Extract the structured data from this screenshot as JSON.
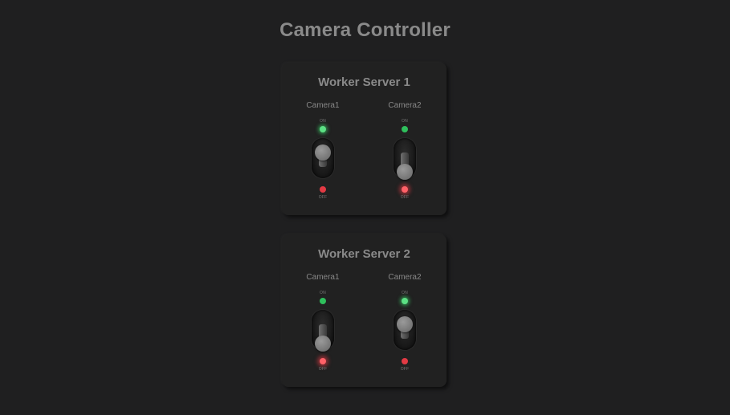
{
  "app": {
    "title": "Camera Controller"
  },
  "servers": [
    {
      "name": "Worker Server 1",
      "cameras": [
        {
          "label": "Camera1",
          "on_label": "ON",
          "off_label": "OFF",
          "state": "on"
        },
        {
          "label": "Camera2",
          "on_label": "ON",
          "off_label": "OFF",
          "state": "off"
        }
      ]
    },
    {
      "name": "Worker Server 2",
      "cameras": [
        {
          "label": "Camera1",
          "on_label": "ON",
          "off_label": "OFF",
          "state": "off"
        },
        {
          "label": "Camera2",
          "on_label": "ON",
          "off_label": "OFF",
          "state": "on"
        }
      ]
    }
  ],
  "colors": {
    "background": "#1f1f20",
    "text": "#8a8a8a",
    "led_on": "#2fbf5c",
    "led_off": "#e23a44"
  }
}
